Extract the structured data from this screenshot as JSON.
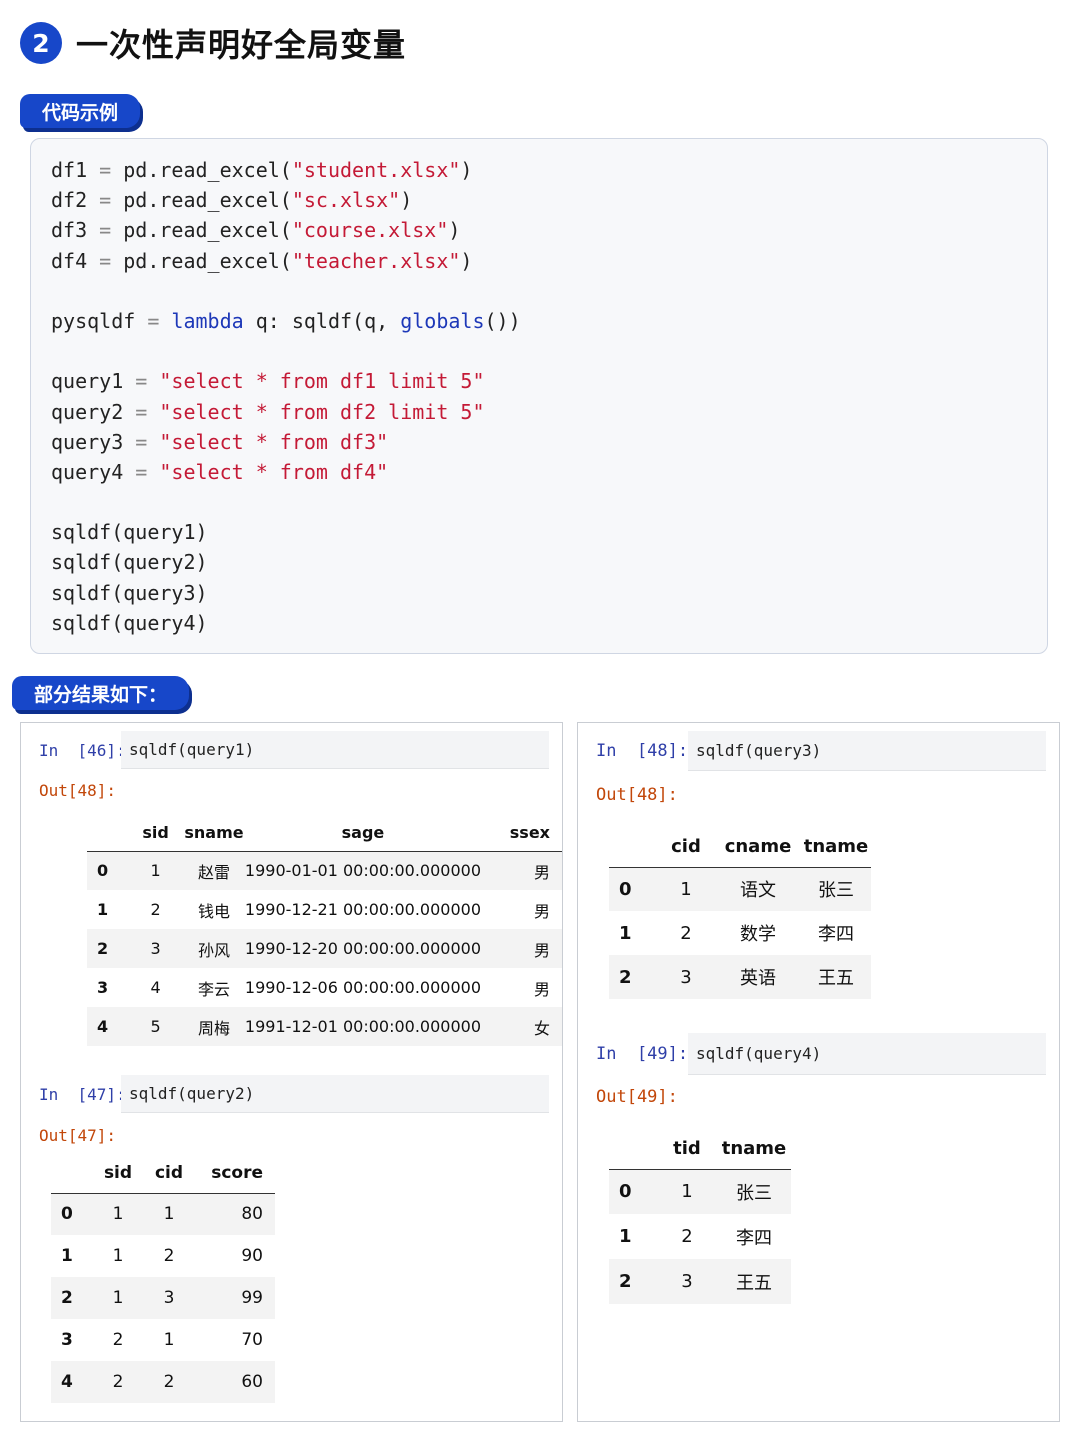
{
  "header": {
    "number": "2",
    "title": "一次性声明好全局变量"
  },
  "labels": {
    "code_example": "代码示例",
    "results": "部分结果如下："
  },
  "code": [
    [
      {
        "t": "df1 "
      },
      {
        "t": "=",
        "c": "op"
      },
      {
        "t": " pd.read_excel("
      },
      {
        "t": "\"student.xlsx\"",
        "c": "str"
      },
      {
        "t": ")"
      }
    ],
    [
      {
        "t": "df2 "
      },
      {
        "t": "=",
        "c": "op"
      },
      {
        "t": " pd.read_excel("
      },
      {
        "t": "\"sc.xlsx\"",
        "c": "str"
      },
      {
        "t": ")"
      }
    ],
    [
      {
        "t": "df3 "
      },
      {
        "t": "=",
        "c": "op"
      },
      {
        "t": " pd.read_excel("
      },
      {
        "t": "\"course.xlsx\"",
        "c": "str"
      },
      {
        "t": ")"
      }
    ],
    [
      {
        "t": "df4 "
      },
      {
        "t": "=",
        "c": "op"
      },
      {
        "t": " pd.read_excel("
      },
      {
        "t": "\"teacher.xlsx\"",
        "c": "str"
      },
      {
        "t": ")"
      }
    ],
    [],
    [
      {
        "t": "pysqldf "
      },
      {
        "t": "=",
        "c": "op"
      },
      {
        "t": " "
      },
      {
        "t": "lambda",
        "c": "kw"
      },
      {
        "t": " q: sqldf(q, "
      },
      {
        "t": "globals",
        "c": "kw"
      },
      {
        "t": "())"
      }
    ],
    [],
    [
      {
        "t": "query1 "
      },
      {
        "t": "=",
        "c": "op"
      },
      {
        "t": " "
      },
      {
        "t": "\"select * from df1 limit 5\"",
        "c": "str"
      }
    ],
    [
      {
        "t": "query2 "
      },
      {
        "t": "=",
        "c": "op"
      },
      {
        "t": " "
      },
      {
        "t": "\"select * from df2 limit 5\"",
        "c": "str"
      }
    ],
    [
      {
        "t": "query3 "
      },
      {
        "t": "=",
        "c": "op"
      },
      {
        "t": " "
      },
      {
        "t": "\"select * from df3\"",
        "c": "str"
      }
    ],
    [
      {
        "t": "query4 "
      },
      {
        "t": "=",
        "c": "op"
      },
      {
        "t": " "
      },
      {
        "t": "\"select * from df4\"",
        "c": "str"
      }
    ],
    [],
    [
      {
        "t": "sqldf(query1)"
      }
    ],
    [
      {
        "t": "sqldf(query2)"
      }
    ],
    [
      {
        "t": "sqldf(query3)"
      }
    ],
    [
      {
        "t": "sqldf(query4)"
      }
    ]
  ],
  "cells": {
    "q1": {
      "in_prompt": "In  [46]:",
      "code": "sqldf(query1)",
      "out_prompt": "Out[48]:",
      "columns": [
        "",
        "sid",
        "sname",
        "sage",
        "ssex"
      ],
      "rows": [
        [
          "0",
          "1",
          "赵雷",
          "1990-01-01 00:00:00.000000",
          "男"
        ],
        [
          "1",
          "2",
          "钱电",
          "1990-12-21 00:00:00.000000",
          "男"
        ],
        [
          "2",
          "3",
          "孙风",
          "1990-12-20 00:00:00.000000",
          "男"
        ],
        [
          "3",
          "4",
          "李云",
          "1990-12-06 00:00:00.000000",
          "男"
        ],
        [
          "4",
          "5",
          "周梅",
          "1991-12-01 00:00:00.000000",
          "女"
        ]
      ]
    },
    "q2": {
      "in_prompt": "In  [47]:",
      "code": "sqldf(query2)",
      "out_prompt": "Out[47]:",
      "columns": [
        "",
        "sid",
        "cid",
        "score"
      ],
      "rows": [
        [
          "0",
          "1",
          "1",
          "80"
        ],
        [
          "1",
          "1",
          "2",
          "90"
        ],
        [
          "2",
          "1",
          "3",
          "99"
        ],
        [
          "3",
          "2",
          "1",
          "70"
        ],
        [
          "4",
          "2",
          "2",
          "60"
        ]
      ]
    },
    "q3": {
      "in_prompt": "In  [48]:",
      "code": "sqldf(query3)",
      "out_prompt": "Out[48]:",
      "columns": [
        "",
        "cid",
        "cname",
        "tname"
      ],
      "rows": [
        [
          "0",
          "1",
          "语文",
          "张三"
        ],
        [
          "1",
          "2",
          "数学",
          "李四"
        ],
        [
          "2",
          "3",
          "英语",
          "王五"
        ]
      ]
    },
    "q4": {
      "in_prompt": "In  [49]:",
      "code": "sqldf(query4)",
      "out_prompt": "Out[49]:",
      "columns": [
        "",
        "tid",
        "tname"
      ],
      "rows": [
        [
          "0",
          "1",
          "张三"
        ],
        [
          "1",
          "2",
          "李四"
        ],
        [
          "2",
          "3",
          "王五"
        ]
      ]
    }
  },
  "colors": {
    "accent": "#1747c9",
    "string": "#c41a36",
    "keyword": "#1d38b8",
    "in_prompt": "#2f3fa8",
    "out_prompt": "#c2470a"
  }
}
